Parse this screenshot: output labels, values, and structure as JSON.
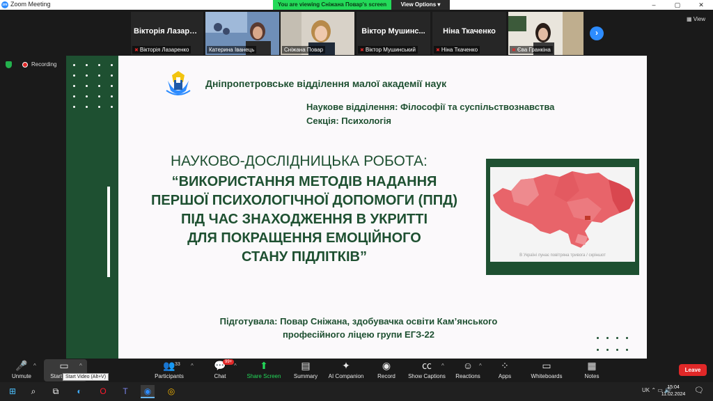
{
  "window": {
    "title": "Zoom Meeting",
    "app_icon": "zoom",
    "controls": [
      "–",
      "▢",
      "✕"
    ]
  },
  "share_banner": {
    "message": "You are viewing Сніжана Повар's screen",
    "options": "View Options"
  },
  "gallery": {
    "view_label": "View",
    "tiles": [
      {
        "big": "Вікторія Лазарь...",
        "label": "Вікторія Лазаренко",
        "muted": true,
        "video": false
      },
      {
        "big": "",
        "label": "Катерина Іванець",
        "muted": false,
        "video": true
      },
      {
        "big": "",
        "label": "Сніжана Повар",
        "muted": false,
        "video": true
      },
      {
        "big": "Віктор Мушинс...",
        "label": "Віктор Мушинський",
        "muted": true,
        "video": false
      },
      {
        "big": "Ніна Ткаченко",
        "label": "Ніна Ткаченко",
        "muted": true,
        "video": false
      },
      {
        "big": "",
        "label": "Єва Гранкіна",
        "muted": true,
        "video": true
      }
    ]
  },
  "status": {
    "recording": "Recording"
  },
  "slide": {
    "org": "Дніпропетровське відділення малої академії наук",
    "department": "Наукове відділення: Філософії та суспільствознавства",
    "section": "Секція: Психологія",
    "work_type": "НАУКОВО-ДОСЛІДНИЦЬКА РОБОТА:",
    "title_lines": [
      "“ВИКОРИСТАННЯ  МЕТОДІВ  НАДАННЯ",
      "ПЕРШОЇ  ПСИХОЛОГІЧНОЇ  ДОПОМОГИ (ППД)",
      "ПІД ЧАС ЗНАХОДЖЕННЯ В УКРИТТІ",
      "ДЛЯ ПОКРАЩЕННЯ  ЕМОЦІЙНОГО",
      "СТАНУ ПІДЛІТКІВ”"
    ],
    "map_caption": "В Україні лунає повітряна тривога / скріншот",
    "prepared_line1": "Підготувала: Повар Сніжана, здобувачка освіти Кам’янського",
    "prepared_line2": "професійного ліцею групи ЕГЗ-22"
  },
  "toolbar": {
    "participants_count": "33",
    "chat_badge": "99+",
    "video_tooltip": "Start Video (Alt+V)",
    "items": [
      {
        "label": "Unmute",
        "icon": "mic-muted-icon"
      },
      {
        "label": "Start Video",
        "icon": "video-off-icon"
      },
      {
        "label": "Participants",
        "icon": "participants-icon"
      },
      {
        "label": "Chat",
        "icon": "chat-icon"
      },
      {
        "label": "Share Screen",
        "icon": "share-screen-icon"
      },
      {
        "label": "Summary",
        "icon": "summary-icon"
      },
      {
        "label": "AI Companion",
        "icon": "ai-companion-icon"
      },
      {
        "label": "Record",
        "icon": "record-icon"
      },
      {
        "label": "Show Captions",
        "icon": "captions-icon"
      },
      {
        "label": "Reactions",
        "icon": "reactions-icon"
      },
      {
        "label": "Apps",
        "icon": "apps-icon"
      },
      {
        "label": "Whiteboards",
        "icon": "whiteboards-icon"
      },
      {
        "label": "Notes",
        "icon": "notes-icon"
      }
    ],
    "leave": "Leave"
  },
  "taskbar": {
    "tray_lang": "UK",
    "time": "15:04",
    "date": "11.02.2024",
    "notification_count": "1"
  },
  "colors": {
    "slide_green": "#1e5031",
    "zoom_blue": "#2d8cff",
    "share_green": "#23d959",
    "leave_red": "#e02828"
  }
}
